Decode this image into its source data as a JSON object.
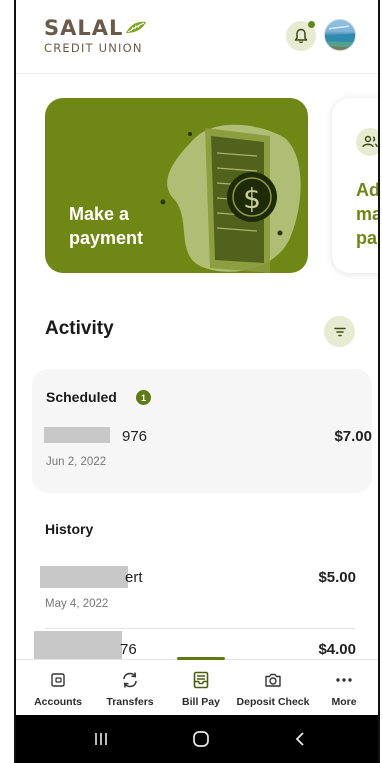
{
  "brand": {
    "name": "SALAL",
    "subtitle": "CREDIT UNION",
    "accent": "#6f8715",
    "brown": "#6b5a47"
  },
  "cards": [
    {
      "title_line1": "Make a",
      "title_line2": "payment"
    },
    {
      "title": "Ad\nma\npa"
    }
  ],
  "activity": {
    "title": "Activity",
    "scheduled": {
      "title": "Scheduled",
      "count": "1",
      "items": [
        {
          "name": "976",
          "date": "Jun 2, 2022",
          "amount": "$7.00"
        }
      ]
    },
    "history": {
      "title": "History",
      "items": [
        {
          "name": "ert",
          "date": "May 4, 2022",
          "amount": "$5.00"
        },
        {
          "name": "76",
          "date": "",
          "amount": "$4.00"
        }
      ]
    }
  },
  "bottom_nav": {
    "items": [
      {
        "label": "Accounts",
        "icon": "accounts-icon"
      },
      {
        "label": "Transfers",
        "icon": "transfers-icon"
      },
      {
        "label": "Bill Pay",
        "icon": "bill-pay-icon",
        "active": true
      },
      {
        "label": "Deposit Check",
        "icon": "camera-icon"
      },
      {
        "label": "More",
        "icon": "more-icon"
      }
    ]
  }
}
